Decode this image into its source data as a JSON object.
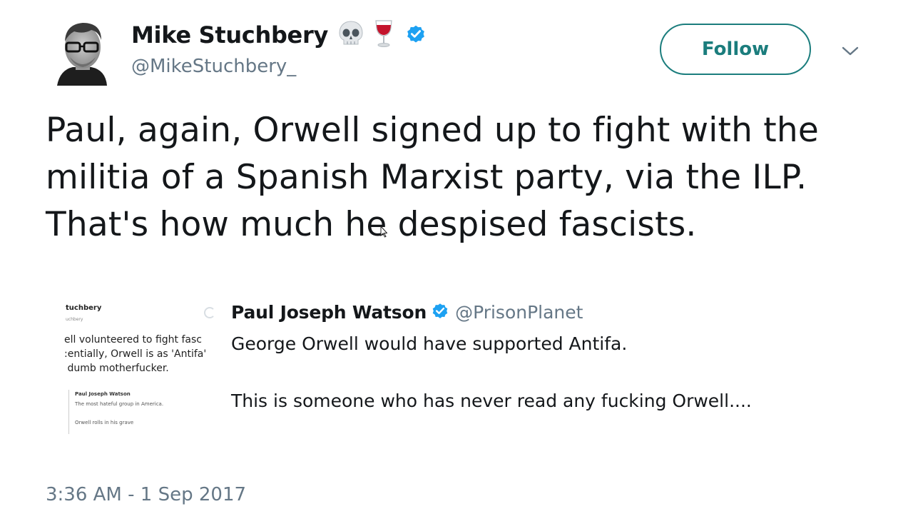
{
  "author": {
    "display_name": "Mike Stuchbery",
    "handle": "@MikeStuchbery_",
    "emojis": [
      "skull-icon",
      "wine-glass-icon"
    ],
    "verified": true
  },
  "follow_button": {
    "label": "Follow"
  },
  "menu": {
    "icon": "chevron-down-icon"
  },
  "tweet": {
    "text": "Paul, again, Orwell signed up to fight with the\nmilitia of a Spanish Marxist party, via the ILP.\nThat's how much he despised fascists."
  },
  "quoted_tweet": {
    "display_name": "Paul Joseph Watson",
    "handle": "@PrisonPlanet",
    "verified": true,
    "text": "George Orwell would have supported Antifa.\n\nThis is someone who has never read any fucking Orwell....",
    "thumbnail": {
      "name": "tuchbery",
      "sub": "uchbery",
      "body": "ell volunteered to fight fasc\n:entially, Orwell is as 'Antifa'\n dumb motherfucker.",
      "inner_name": "Paul Joseph Watson",
      "inner_text_1": "The most hateful group in America.",
      "inner_text_2": "Orwell rolls in his grave"
    }
  },
  "timestamp": "3:36 AM - 1 Sep 2017",
  "colors": {
    "text": "#14171a",
    "secondary": "#657786",
    "follow_accent": "#1b7d7d",
    "verified_blue": "#1da1f2"
  }
}
